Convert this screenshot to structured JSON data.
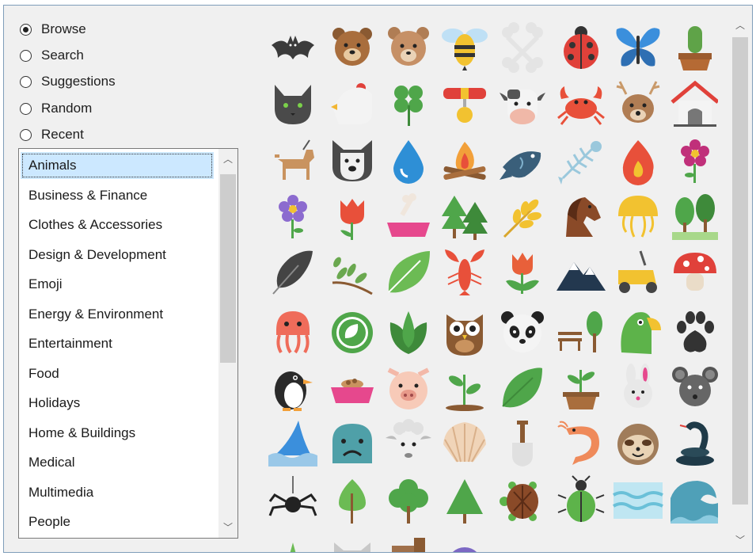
{
  "modes": [
    {
      "label": "Browse",
      "selected": true
    },
    {
      "label": "Search",
      "selected": false
    },
    {
      "label": "Suggestions",
      "selected": false
    },
    {
      "label": "Random",
      "selected": false
    },
    {
      "label": "Recent",
      "selected": false
    }
  ],
  "categories": {
    "selected_index": 0,
    "items": [
      "Animals",
      "Business & Finance",
      "Clothes & Accessories",
      "Design & Development",
      "Emoji",
      "Energy & Environment",
      "Entertainment",
      "Food",
      "Holidays",
      "Home & Buildings",
      "Medical",
      "Multimedia",
      "People"
    ]
  },
  "icons": [
    "bat-icon",
    "bear-icon",
    "bear-alt-icon",
    "bee-icon",
    "bone-icon",
    "ladybug-icon",
    "butterfly-icon",
    "cactus-icon",
    "cat-icon",
    "chicken-icon",
    "clover-icon",
    "collar-icon",
    "cow-icon",
    "crab-icon",
    "deer-icon",
    "doghouse-icon",
    "dog-walking-icon",
    "bulldog-icon",
    "water-drop-icon",
    "campfire-icon",
    "fish-icon",
    "fish-bone-icon",
    "flame-icon",
    "flower-icon",
    "purple-flower-icon",
    "tulip-icon",
    "dog-bowl-icon",
    "forest-icon",
    "wheat-icon",
    "horse-icon",
    "jellyfish-icon",
    "grove-icon",
    "feather-icon",
    "twig-icon",
    "leaf-icon",
    "lobster-icon",
    "tulip-alt-icon",
    "mountains-icon",
    "lawn-mower-icon",
    "mushroom-icon",
    "octopus-icon",
    "eco-badge-icon",
    "leaves-icon",
    "owl-icon",
    "panda-icon",
    "park-bench-icon",
    "parrot-icon",
    "paw-icon",
    "penguin-icon",
    "pet-food-bowl-icon",
    "pig-icon",
    "sprout-icon",
    "leaf-alt-icon",
    "potted-plant-icon",
    "rabbit-icon",
    "rat-icon",
    "shark-icon",
    "seal-icon",
    "sheep-icon",
    "seashell-icon",
    "shovel-icon",
    "shrimp-icon",
    "sloth-icon",
    "snake-icon",
    "spider-icon",
    "tree-icon",
    "round-tree-icon",
    "pine-tree-icon",
    "turtle-icon",
    "beetle-icon",
    "waves-icon",
    "tidal-wave-icon",
    "small-tree-icon",
    "wolf-icon",
    "stump-icon",
    "yarn-ball-icon"
  ],
  "scroll": {
    "up_glyph": "︿",
    "down_glyph": "﹀"
  }
}
